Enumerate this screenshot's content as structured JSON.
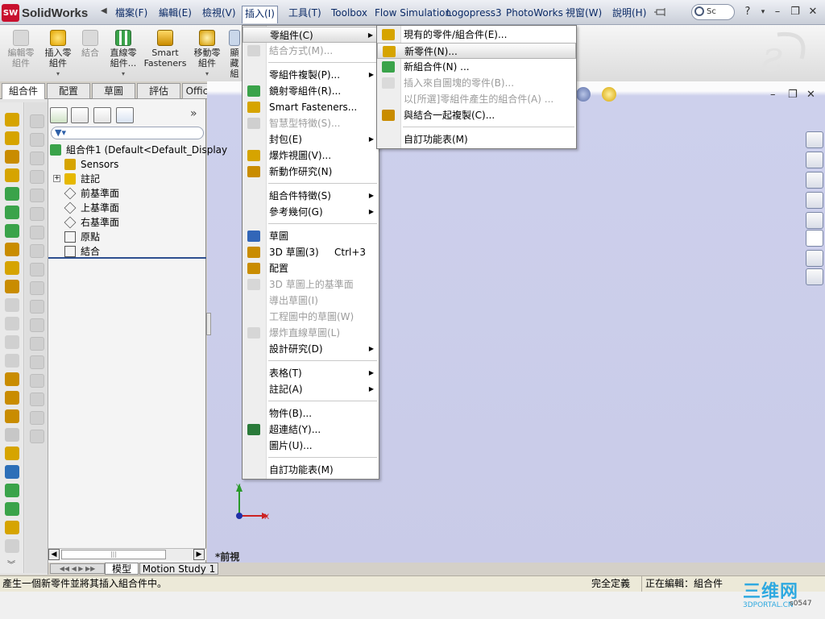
{
  "app": {
    "brand": "SolidWorks",
    "brand_prefix": "SW"
  },
  "menubar": {
    "items": [
      "檔案(F)",
      "編輯(E)",
      "檢視(V)",
      "插入(I)",
      "工具(T)",
      "Toolbox",
      "Flow Simulation",
      "Logopress3",
      "PhotoWorks",
      "視窗(W)",
      "說明(H)"
    ],
    "search_text": "Sc",
    "help_glyph": "?"
  },
  "commandmanager": {
    "buttons": [
      {
        "label": "編輯零\n組件",
        "icon": "edit-component-icon",
        "disabled": true
      },
      {
        "label": "插入零\n組件",
        "icon": "insert-component-icon",
        "disabled": false
      },
      {
        "label": "結合",
        "icon": "mate-icon",
        "disabled": true
      },
      {
        "label": "直線零\n組件...",
        "icon": "linear-pattern-icon",
        "disabled": false
      },
      {
        "label": "Smart\nFasteners",
        "icon": "smart-fasteners-icon",
        "disabled": false
      },
      {
        "label": "移動零\n組件",
        "icon": "move-component-icon",
        "disabled": false
      },
      {
        "label": "顯\n藏\n組",
        "icon": "show-hide-icon",
        "disabled": false
      }
    ]
  },
  "tabs": [
    "組合件",
    "配置",
    "草圖",
    "評估",
    "Office 產品"
  ],
  "featuremanager": {
    "tree": [
      {
        "label": "組合件1  (Default<Default_Display",
        "icon": "assembly-icon",
        "level": 0
      },
      {
        "label": "Sensors",
        "icon": "sensor-icon",
        "level": 1
      },
      {
        "label": "註記",
        "icon": "annotation-icon",
        "level": 1,
        "expander": "+"
      },
      {
        "label": "前基準面",
        "icon": "plane-icon",
        "level": 1
      },
      {
        "label": "上基準面",
        "icon": "plane-icon",
        "level": 1
      },
      {
        "label": "右基準面",
        "icon": "plane-icon",
        "level": 1
      },
      {
        "label": "原點",
        "icon": "origin-icon",
        "level": 1
      },
      {
        "label": "結合",
        "icon": "mates-icon",
        "level": 1
      }
    ],
    "collapse_glyph": "»",
    "scroll_thumb": "|||"
  },
  "insert_menu": {
    "items": [
      {
        "label": "零組件(C)",
        "submenu": true,
        "highlighted": true,
        "icon": ""
      },
      {
        "label": "結合方式(M)...",
        "disabled": true,
        "icon": "mate-icon"
      },
      {
        "sep": true
      },
      {
        "label": "零組件複製(P)...",
        "submenu": true,
        "icon": ""
      },
      {
        "label": "鏡射零組件(R)...",
        "icon": "mirror-component-icon"
      },
      {
        "label": "Smart Fasteners...",
        "icon": "smart-fasteners-icon"
      },
      {
        "label": "智慧型特徵(S)...",
        "disabled": true,
        "icon": "smart-feature-icon"
      },
      {
        "label": "封包(E)",
        "submenu": true,
        "icon": ""
      },
      {
        "label": "爆炸視圖(V)...",
        "icon": "exploded-view-icon"
      },
      {
        "label": "新動作研究(N)",
        "icon": "motion-study-icon"
      },
      {
        "sep": true
      },
      {
        "label": "組合件特徵(S)",
        "submenu": true,
        "icon": ""
      },
      {
        "label": "參考幾何(G)",
        "submenu": true,
        "icon": ""
      },
      {
        "sep": true
      },
      {
        "label": "草圖",
        "icon": "sketch-icon"
      },
      {
        "label": "3D 草圖(3)",
        "shortcut": "Ctrl+3",
        "icon": "3d-sketch-icon"
      },
      {
        "label": "配置",
        "icon": "layout-icon"
      },
      {
        "label": "3D 草圖上的基準面",
        "disabled": true,
        "icon": "3d-sketch-plane-icon"
      },
      {
        "label": "導出草圖(I)",
        "disabled": true,
        "icon": ""
      },
      {
        "label": "工程圖中的草圖(W)",
        "disabled": true,
        "icon": ""
      },
      {
        "label": "爆炸直線草圖(L)",
        "disabled": true,
        "icon": "explode-line-icon"
      },
      {
        "label": "設計研究(D)",
        "submenu": true,
        "icon": ""
      },
      {
        "sep": true
      },
      {
        "label": "表格(T)",
        "submenu": true,
        "icon": ""
      },
      {
        "label": "註記(A)",
        "submenu": true,
        "icon": ""
      },
      {
        "sep": true
      },
      {
        "label": "物件(B)...",
        "icon": ""
      },
      {
        "label": "超連結(Y)...",
        "icon": "hyperlink-icon"
      },
      {
        "label": "圖片(U)...",
        "icon": ""
      },
      {
        "sep": true
      },
      {
        "label": "自訂功能表(M)",
        "icon": ""
      }
    ]
  },
  "component_submenu": {
    "items": [
      {
        "label": "現有的零件/組合件(E)...",
        "icon": "existing-part-icon"
      },
      {
        "label": "新零件(N)...",
        "icon": "new-part-icon",
        "highlighted": true
      },
      {
        "label": "新組合件(N) ...",
        "icon": "new-assembly-icon"
      },
      {
        "label": "插入來自圖塊的零件(B)...",
        "disabled": true,
        "icon": "part-from-block-icon"
      },
      {
        "label": "以[所選]零組件產生的組合件(A) ...",
        "disabled": true,
        "icon": ""
      },
      {
        "label": "與結合一起複製(C)...",
        "icon": "copy-with-mates-icon"
      },
      {
        "sep": true
      },
      {
        "label": "自訂功能表(M)",
        "icon": ""
      }
    ]
  },
  "graphics": {
    "view_label": "*前視",
    "axis_x": "X",
    "axis_y": "Y"
  },
  "bottom_tabs": [
    "模型",
    "Motion Study 1"
  ],
  "status": {
    "message": "產生一個新零件並將其插入組合件中。",
    "state": "完全定義",
    "editing": "正在編輯：組合件"
  },
  "watermark": {
    "title": "三维网",
    "subtitle": "3DPORTAL.CN",
    "tag": "s0547"
  },
  "colors": {
    "brand_red": "#c8102e",
    "menu_highlight": "#dcdcdc",
    "graphics_bg": "#c9cbe8"
  }
}
